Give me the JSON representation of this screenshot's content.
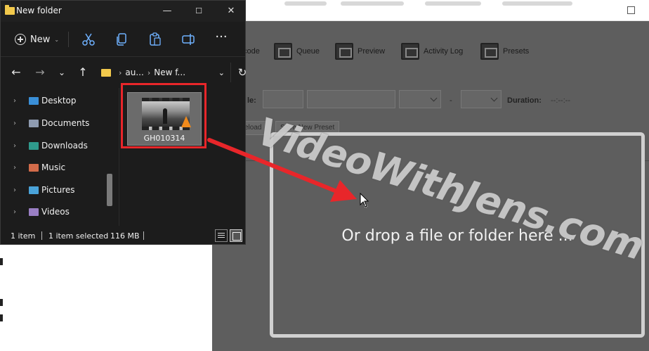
{
  "explorer": {
    "title": "New folder",
    "window_controls": {
      "minimize": "—",
      "maximize": "☐",
      "close": "✕"
    },
    "commandbar": {
      "new_label": "New"
    },
    "address": {
      "crumb1": "au...",
      "crumb2": "New f..."
    },
    "nav_items": [
      {
        "label": "Desktop",
        "icon": "desktop-folder-icon",
        "color": "#3a8fd8"
      },
      {
        "label": "Documents",
        "icon": "documents-folder-icon",
        "color": "#8e9bb0"
      },
      {
        "label": "Downloads",
        "icon": "downloads-folder-icon",
        "color": "#2f9a8c"
      },
      {
        "label": "Music",
        "icon": "music-folder-icon",
        "color": "#d26b4a"
      },
      {
        "label": "Pictures",
        "icon": "pictures-folder-icon",
        "color": "#4aa3d9"
      },
      {
        "label": "Videos",
        "icon": "videos-folder-icon",
        "color": "#9a7fc4"
      }
    ],
    "file": {
      "name": "GH010314",
      "icon": "video-file-icon"
    },
    "status": {
      "count": "1 item",
      "selected": "1 item selected",
      "size": "116 MB"
    }
  },
  "handbrake": {
    "toolbar": [
      {
        "label": "code",
        "icon": "encode-icon"
      },
      {
        "label": "Queue",
        "icon": "queue-icon"
      },
      {
        "label": "Preview",
        "icon": "preview-icon"
      },
      {
        "label": "Activity Log",
        "icon": "activity-log-icon"
      },
      {
        "label": "Presets",
        "icon": "presets-icon"
      }
    ],
    "row": {
      "title_label": "le:",
      "dash": "-",
      "duration_label": "Duration:",
      "duration_value": "--:--:--"
    },
    "buttons": {
      "reload": "eload",
      "save_preset": "Save New Preset"
    },
    "drop_text": "Or drop a file or folder here ..."
  },
  "watermark": "VideoWithJens.com",
  "colors": {
    "accent_red": "#e8262a",
    "explorer_bg": "#1c1c1c",
    "dim_overlay": "#5e5e5e"
  }
}
